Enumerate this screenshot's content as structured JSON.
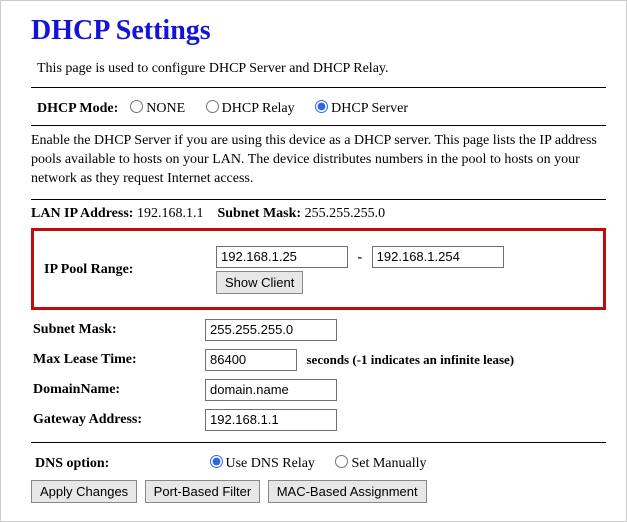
{
  "title": "DHCP Settings",
  "intro": "This page is used to configure DHCP Server and DHCP Relay.",
  "dhcp_mode": {
    "label": "DHCP Mode:",
    "options": [
      "NONE",
      "DHCP Relay",
      "DHCP Server"
    ],
    "selected": "DHCP Server"
  },
  "server_desc": "Enable the DHCP Server if you are using this device as a DHCP server. This page lists the IP address pools available to hosts on your LAN. The device distributes numbers in the pool to hosts on your network as they request Internet access.",
  "lan": {
    "ip_label": "LAN IP Address:",
    "ip_value": "192.168.1.1",
    "mask_label": "Subnet Mask:",
    "mask_value": "255.255.255.0"
  },
  "form": {
    "ip_pool": {
      "label": "IP Pool Range:",
      "start": "192.168.1.25",
      "end": "192.168.1.254",
      "show_client_btn": "Show Client"
    },
    "subnet_mask": {
      "label": "Subnet Mask:",
      "value": "255.255.255.0"
    },
    "max_lease": {
      "label": "Max Lease Time:",
      "value": "86400",
      "hint": "seconds (-1 indicates an infinite lease)"
    },
    "domain_name": {
      "label": "DomainName:",
      "value": "domain.name"
    },
    "gateway": {
      "label": "Gateway Address:",
      "value": "192.168.1.1"
    },
    "dns_option": {
      "label": "DNS option:",
      "options": [
        "Use DNS Relay",
        "Set Manually"
      ],
      "selected": "Use DNS Relay"
    }
  },
  "buttons": {
    "apply": "Apply Changes",
    "port_filter": "Port-Based Filter",
    "mac_assign": "MAC-Based Assignment"
  }
}
